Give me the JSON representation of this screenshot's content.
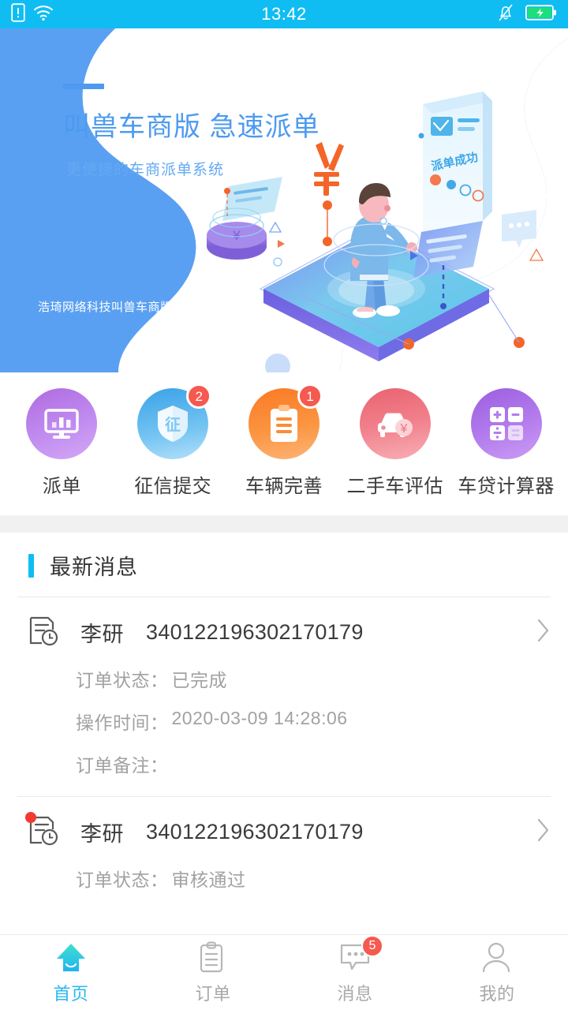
{
  "status_bar": {
    "time": "13:42",
    "left_icons": [
      "sim-card-icon",
      "wifi-icon"
    ],
    "right_icons": [
      "bell-muted-icon",
      "battery-charging-icon"
    ],
    "background_color": "#10bdf2"
  },
  "banner": {
    "title": "叫兽车商版 急速派单",
    "subtitle": "更便捷的车商派单系统",
    "footer": "浩琦网络科技叫兽车商版",
    "illustration_label": "派单成功",
    "accent_color": "#4d9af0",
    "background_color": "#5aa0f2"
  },
  "menu": {
    "items": [
      {
        "label": "派单",
        "icon": "monitor-chart-icon",
        "badge": "",
        "color": "#c08cf0"
      },
      {
        "label": "征信提交",
        "icon": "shield-credit-icon",
        "badge": "2",
        "color": "#74c4f2"
      },
      {
        "label": "车辆完善",
        "icon": "clipboard-icon",
        "badge": "1",
        "color": "#fb9440"
      },
      {
        "label": "二手车评估",
        "icon": "car-yuan-icon",
        "badge": "",
        "color": "#f1808c"
      },
      {
        "label": "车贷计算器",
        "icon": "calculator-icon",
        "badge": "",
        "color": "#b47ced"
      }
    ],
    "badge_color": "#f5594f"
  },
  "messages": {
    "section_title": "最新消息",
    "labels": {
      "status": "订单状态：",
      "time": "操作时间：",
      "remark": "订单备注："
    },
    "items": [
      {
        "name": "李研",
        "id_number": "340122196302170179",
        "status": "已完成",
        "time": "2020-03-09 14:28:06",
        "remark": "",
        "unread": false
      },
      {
        "name": "李研",
        "id_number": "340122196302170179",
        "status": "审核通过",
        "time": "",
        "remark": "",
        "unread": true
      }
    ]
  },
  "tabbar": {
    "active_color": "#29b8f0",
    "inactive_color": "#a8a8a8",
    "items": [
      {
        "label": "首页",
        "icon": "home-icon",
        "badge": "",
        "active": true
      },
      {
        "label": "订单",
        "icon": "clipboard-icon",
        "badge": "",
        "active": false
      },
      {
        "label": "消息",
        "icon": "chat-icon",
        "badge": "5",
        "active": false
      },
      {
        "label": "我的",
        "icon": "person-icon",
        "badge": "",
        "active": false
      }
    ]
  }
}
